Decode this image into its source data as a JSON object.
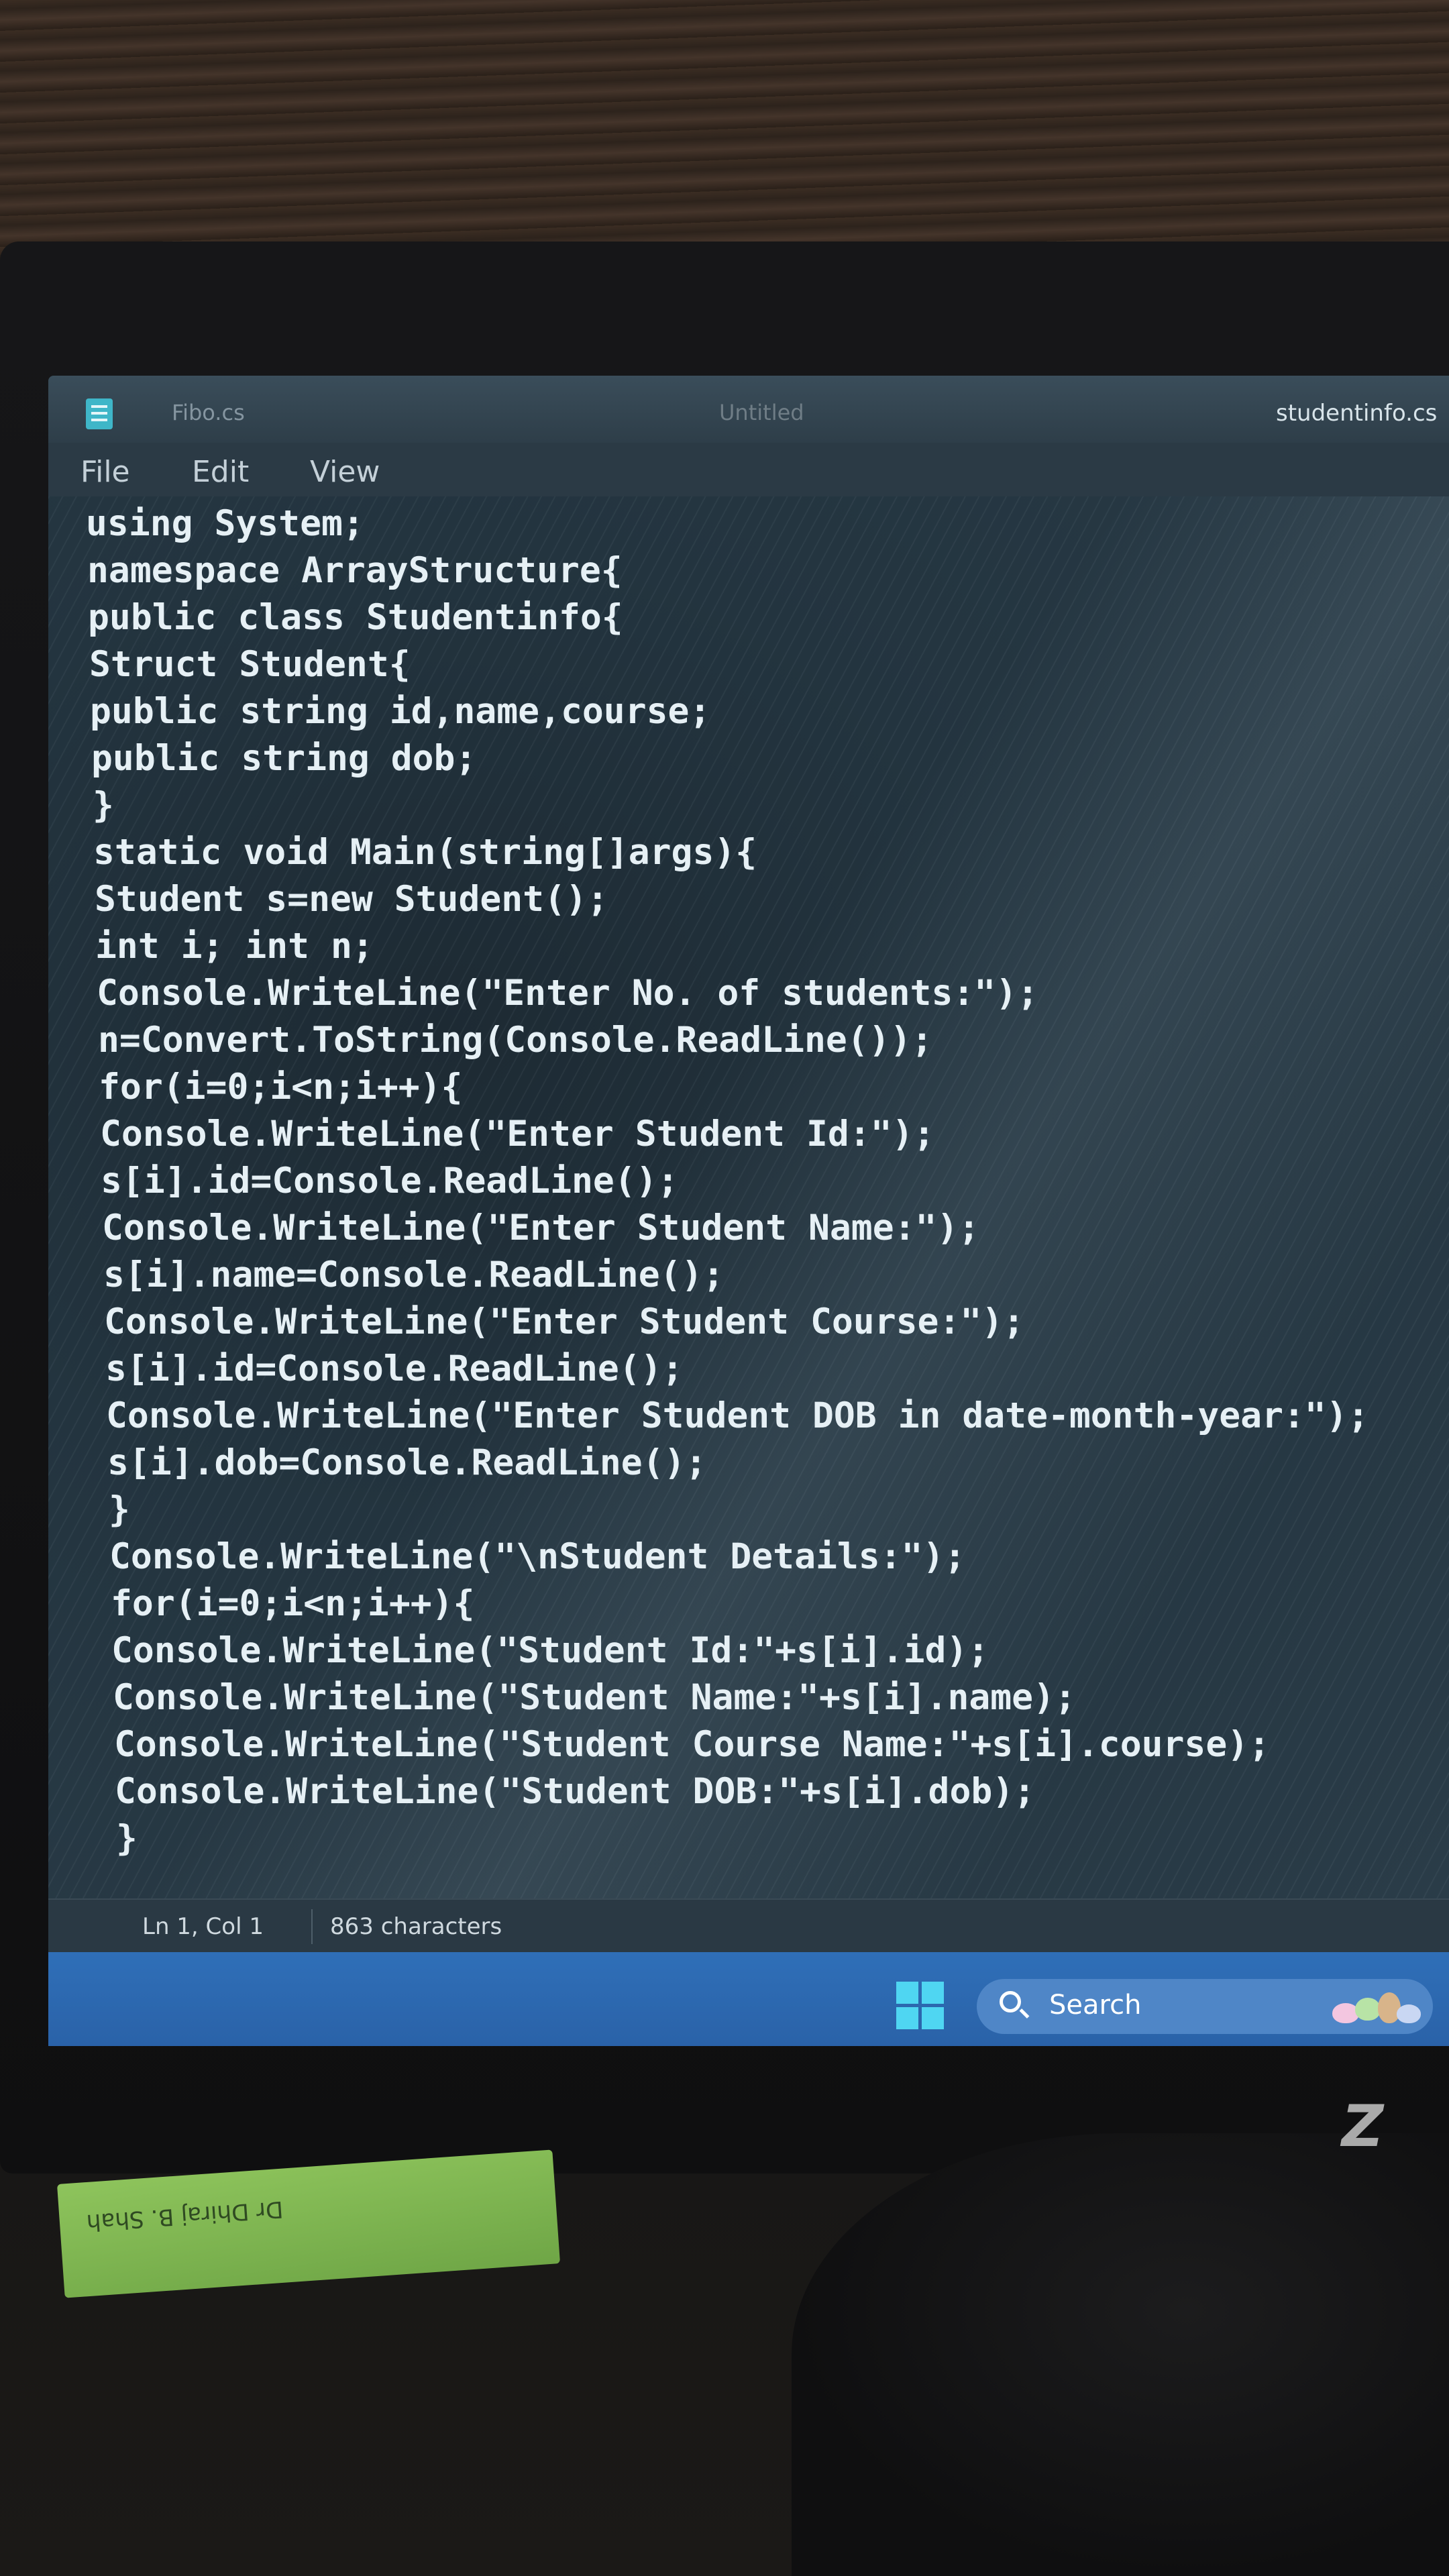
{
  "window": {
    "tabs": [
      {
        "label": "Fibo.cs"
      },
      {
        "label": "Untitled"
      },
      {
        "label": "studentinfo.cs"
      }
    ]
  },
  "menu": {
    "items": [
      "File",
      "Edit",
      "View"
    ]
  },
  "editor": {
    "lines": [
      "using System;",
      "namespace ArrayStructure{",
      "public class Studentinfo{",
      "Struct Student{",
      "public string id,name,course;",
      "public string dob;",
      "}",
      "static void Main(string[]args){",
      "Student s=new Student();",
      "int i; int n;",
      "Console.WriteLine(\"Enter No. of students:\");",
      "n=Convert.ToString(Console.ReadLine());",
      "for(i=0;i<n;i++){",
      "Console.WriteLine(\"Enter Student Id:\");",
      "s[i].id=Console.ReadLine();",
      "Console.WriteLine(\"Enter Student Name:\");",
      "s[i].name=Console.ReadLine();",
      "Console.WriteLine(\"Enter Student Course:\");",
      "s[i].id=Console.ReadLine();",
      "Console.WriteLine(\"Enter Student DOB in date-month-year:\");",
      "s[i].dob=Console.ReadLine();",
      "}",
      "Console.WriteLine(\"\\nStudent Details:\");",
      "for(i=0;i<n;i++){",
      "Console.WriteLine(\"Student Id:\"+s[i].id);",
      "Console.WriteLine(\"Student Name:\"+s[i].name);",
      "Console.WriteLine(\"Student Course Name:\"+s[i].course);",
      "Console.WriteLine(\"Student DOB:\"+s[i].dob);",
      "}"
    ]
  },
  "statusbar": {
    "position": "Ln 1, Col 1",
    "characters": "863 characters"
  },
  "taskbar": {
    "search_label": "Search"
  },
  "scene": {
    "note_text": "Dr Dhiraj B. Shah",
    "brand_text": "Z"
  },
  "colors": {
    "accent": "#3fb6c8",
    "taskbar": "#2f6fb8",
    "editor_bg": "#23343f",
    "code_text": "#e6f0f5"
  },
  "icons": {
    "app": "notepad-icon",
    "start": "windows-logo-icon",
    "search": "search-icon"
  }
}
